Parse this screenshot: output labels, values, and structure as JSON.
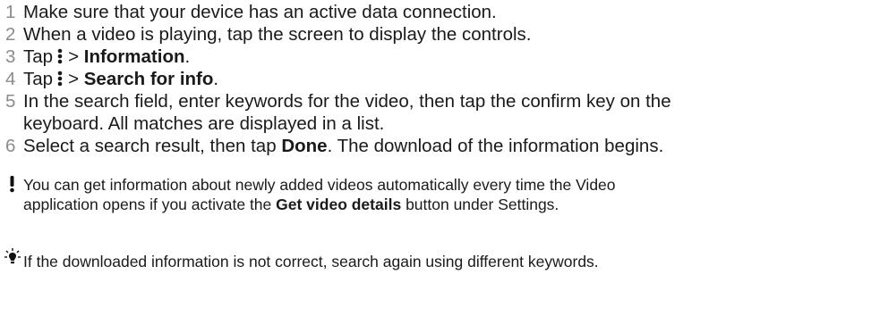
{
  "steps": [
    {
      "number": "1",
      "text": "Make sure that your device has an active data connection."
    },
    {
      "number": "2",
      "text": "When a video is playing, tap the screen to display the controls."
    },
    {
      "number": "3",
      "prefix": "Tap",
      "separator": ">",
      "bold": "Information",
      "suffix": "."
    },
    {
      "number": "4",
      "prefix": "Tap",
      "separator": ">",
      "bold": "Search for info",
      "suffix": "."
    },
    {
      "number": "5",
      "line1": "In the search field, enter keywords for the video, then tap the confirm key on the",
      "line2": "keyboard. All matches are displayed in a list."
    },
    {
      "number": "6",
      "prefix": "Select a search result, then tap",
      "bold": "Done",
      "suffix": ". The download of the information begins."
    }
  ],
  "note": {
    "icon": "exclamation-icon",
    "line1": "You can get information about newly added videos automatically every time the Video",
    "line2_prefix": "application opens if you activate the",
    "line2_bold": "Get video details",
    "line2_suffix": "button under Settings."
  },
  "tip": {
    "icon": "lightbulb-icon",
    "text": "If the downloaded information is not correct, search again using different keywords."
  },
  "colors": {
    "text": "#1a1a1a",
    "step_number": "#8c8c8c"
  }
}
